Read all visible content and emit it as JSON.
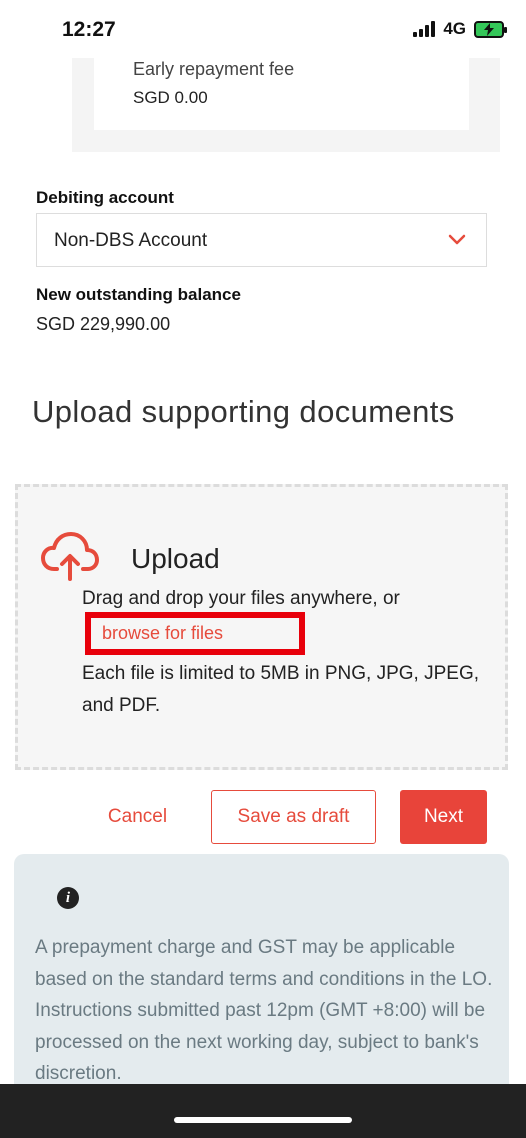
{
  "status_bar": {
    "time": "12:27",
    "network": "4G",
    "battery_color": "#34c759"
  },
  "summary": {
    "fee_label": "Early repayment fee",
    "fee_value": "SGD 0.00"
  },
  "debiting": {
    "label": "Debiting account",
    "selected": "Non-DBS Account",
    "chevron_icon": "chevron-down-icon"
  },
  "balance": {
    "label": "New outstanding balance",
    "value": "SGD 229,990.00"
  },
  "upload": {
    "title": "Upload supporting documents",
    "heading": "Upload",
    "drag_text": "Drag and drop your files anywhere, or",
    "browse_link": "browse for files",
    "limit_text": "Each file is limited to 5MB in PNG, JPG, JPEG, and PDF.",
    "icon": "cloud-upload-icon"
  },
  "actions": {
    "cancel": "Cancel",
    "save_draft": "Save as draft",
    "next": "Next"
  },
  "info": {
    "icon": "info-icon",
    "text": "A prepayment charge and GST may be applicable based on the standard terms and conditions in the LO. Instructions submitted past 12pm (GMT +8:00) will be processed on the next working day, subject to bank's discretion."
  },
  "colors": {
    "accent": "#e64b3c",
    "next_bg": "#e8443a",
    "highlight": "#e8000b",
    "info_bg": "#e4ebee"
  }
}
